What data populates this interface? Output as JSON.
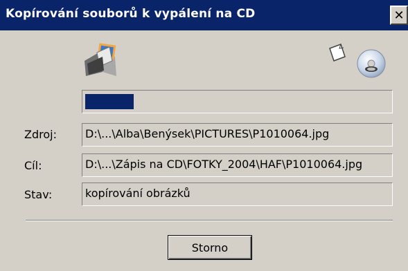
{
  "window": {
    "title": "Kopírování souborů k vypálení na CD",
    "close_glyph": "✕"
  },
  "icons": {
    "source": "folder-with-images-icon",
    "page": "document-page-icon",
    "target": "cd-disc-icon"
  },
  "progress": {
    "fraction": 0.16,
    "color": "#0a246a"
  },
  "fields": {
    "source": {
      "label": "Zdroj:",
      "value": "D:\\...\\Alba\\Benýsek\\PICTURES\\P1010064.jpg"
    },
    "target": {
      "label": "Cíl:",
      "value": "D:\\...\\Zápis na CD\\FOTKY_2004\\HAF\\P1010064.jpg"
    },
    "status": {
      "label": "Stav:",
      "value": "kopírování obrázků"
    }
  },
  "buttons": {
    "cancel_label": "Storno"
  },
  "colors": {
    "titlebar": "#0a246a",
    "dialog_bg": "#d4d0c8"
  }
}
